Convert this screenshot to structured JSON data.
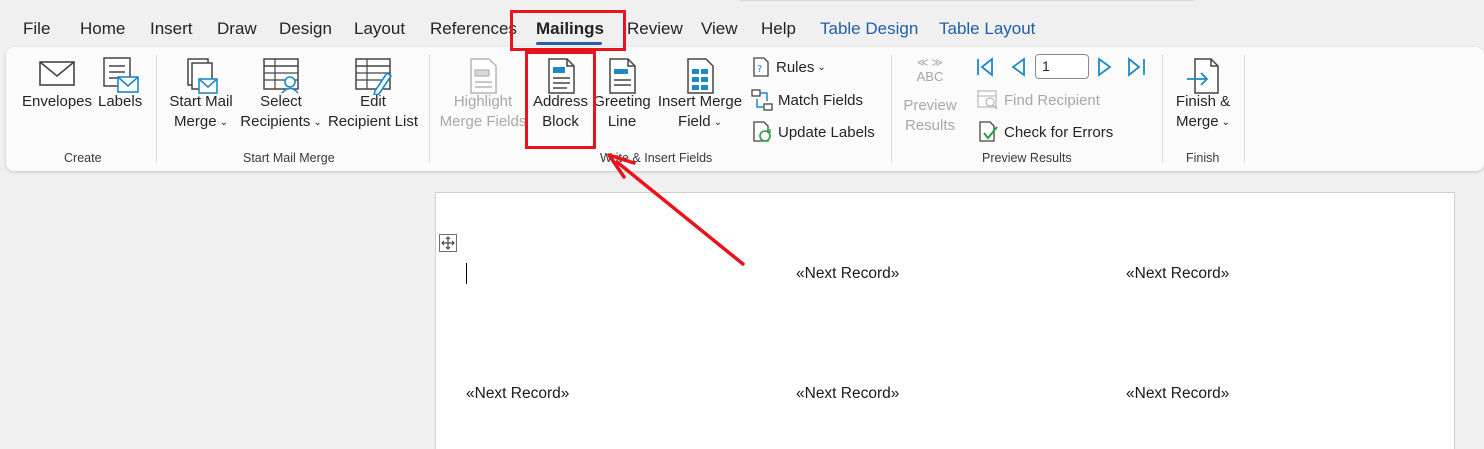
{
  "tabs": [
    {
      "label": "File",
      "id": "file"
    },
    {
      "label": "Home",
      "id": "home"
    },
    {
      "label": "Insert",
      "id": "insert"
    },
    {
      "label": "Draw",
      "id": "draw"
    },
    {
      "label": "Design",
      "id": "design"
    },
    {
      "label": "Layout",
      "id": "layout"
    },
    {
      "label": "References",
      "id": "references"
    },
    {
      "label": "Mailings",
      "id": "mailings",
      "active": true
    },
    {
      "label": "Review",
      "id": "review"
    },
    {
      "label": "View",
      "id": "view"
    },
    {
      "label": "Help",
      "id": "help"
    },
    {
      "label": "Table Design",
      "id": "table-design",
      "contextual": true
    },
    {
      "label": "Table Layout",
      "id": "table-layout",
      "contextual": true
    }
  ],
  "ribbon": {
    "create": {
      "label": "Create",
      "envelopes": "Envelopes",
      "labels": "Labels"
    },
    "start_mail_merge": {
      "label": "Start Mail Merge",
      "start_line1": "Start Mail",
      "start_line2": "Merge",
      "select_line1": "Select",
      "select_line2": "Recipients",
      "edit_line1": "Edit",
      "edit_line2": "Recipient List"
    },
    "write_insert": {
      "label": "Write & Insert Fields",
      "highlight_line1": "Highlight",
      "highlight_line2": "Merge Fields",
      "address_line1": "Address",
      "address_line2": "Block",
      "greeting_line1": "Greeting",
      "greeting_line2": "Line",
      "insert_line1": "Insert Merge",
      "insert_line2": "Field",
      "rules": "Rules",
      "match_fields": "Match Fields",
      "update_labels": "Update Labels"
    },
    "preview": {
      "label": "Preview Results",
      "abc_top": "≪ ≫",
      "abc": "ABC",
      "preview_line1": "Preview",
      "preview_line2": "Results",
      "record_value": "1",
      "find_recipient": "Find Recipient",
      "check_errors": "Check for Errors"
    },
    "finish": {
      "label": "Finish",
      "finish_line1": "Finish &",
      "finish_line2": "Merge"
    }
  },
  "document": {
    "cells": [
      "«Next Record»",
      "«Next Record»",
      "«Next Record»",
      "«Next Record»",
      "«Next Record»"
    ]
  },
  "colors": {
    "accent": "#2b5fae",
    "contextual_tab": "#1f5fa9",
    "highlight_red": "#e8131b",
    "icon_blue": "#1e88c9"
  }
}
